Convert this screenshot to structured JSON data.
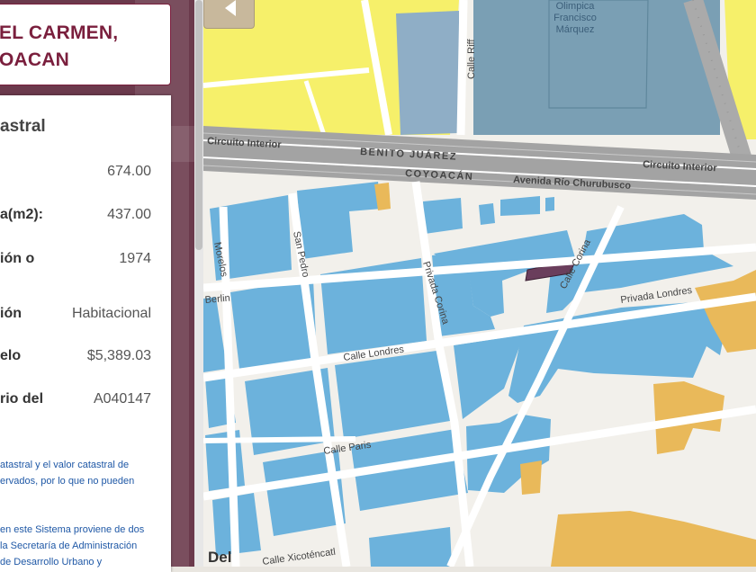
{
  "title_lines": [
    "EL CARMEN,",
    "OACAN"
  ],
  "panel": {
    "section_title": "astral",
    "rows": [
      {
        "label": "",
        "value": "674.00"
      },
      {
        "label": "a(m2):",
        "value": "437.00"
      },
      {
        "label": "ión o",
        "value": "1974"
      },
      {
        "label": "ión",
        "value": "Habitacional"
      },
      {
        "label": "elo",
        "value": "$5,389.03"
      },
      {
        "label": "rio del",
        "value": "A040147"
      }
    ],
    "notes": [
      "atastral y el valor catastral de",
      "ervados, por lo que no pueden",
      "en este Sistema proviene de dos",
      "la Secretaría de Administración",
      "de Desarrollo Urbano y"
    ]
  },
  "map": {
    "streets": {
      "circuito_interior_left": "Circuito Interior",
      "circuito_interior_right": "Circuito Interior",
      "benito_juarez": "BENITO JUÁREZ",
      "coyoacan": "COYOACÁN",
      "rio_churubusco": "Avenida Río Churubusco",
      "calle_riff": "Calle Riff",
      "morelos": "Morelos",
      "san_pedro": "San Pedro",
      "berlin": "Berlin",
      "privada_corina": "Privada Corina",
      "calle_corina": "Calle Corina",
      "privada_londres": "Privada Londres",
      "calle_londres": "Calle Londres",
      "calle_paris": "Calle Paris",
      "calle_xicotencatl": "Calle Xicoténcatl"
    },
    "poi_lines": [
      "Olimpica",
      "Francisco",
      "Márquez"
    ],
    "corner_text": "Del"
  },
  "colors": {
    "maroon": "#7a1f3d",
    "residential_blue": "#6cb2dc",
    "yellow_zone": "#f6f06a",
    "orange_zone": "#e9b95a",
    "sports_block": "#7a9fb4",
    "highlight_parcel": "#6a3e5c"
  },
  "icons": {
    "back": "left-arrow-icon"
  }
}
